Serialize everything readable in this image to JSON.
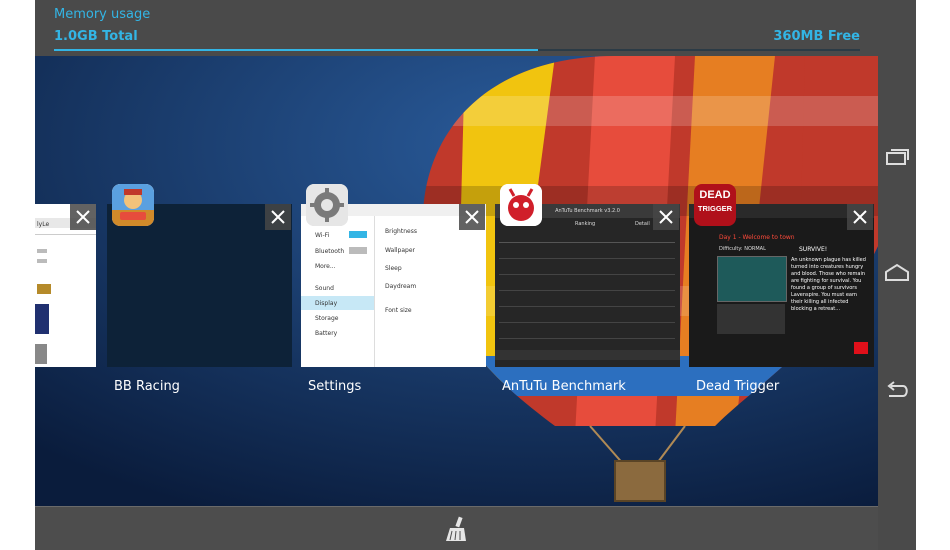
{
  "memory": {
    "title": "Memory usage",
    "total": "1.0GB Total",
    "free": "360MB Free",
    "used_fraction": 0.6
  },
  "recent_apps": [
    {
      "label": "BB Racing",
      "icon": "bb-racing-icon"
    },
    {
      "label": "Settings",
      "icon": "settings-gear-icon"
    },
    {
      "label": "AnTuTu Benchmark",
      "icon": "antutu-icon"
    },
    {
      "label": "Dead Trigger",
      "icon": "dead-trigger-icon"
    }
  ],
  "settings_preview": {
    "wifi": "Wi-Fi",
    "bluetooth": "Bluetooth",
    "more": "More...",
    "sound": "Sound",
    "display": "Display",
    "storage": "Storage",
    "battery": "Battery",
    "brightness": "Brightness",
    "wallpaper": "Wallpaper",
    "sleep": "Sleep",
    "daydream": "Daydream",
    "font_size": "Font size"
  },
  "antutu_preview": {
    "header": "AnTuTu Benchmark v3.2.0",
    "tab_ranking": "Ranking",
    "tab_detail": "Detail"
  },
  "dead_trigger_preview": {
    "logo_line1": "DEAD",
    "logo_line2": "TRIGGER",
    "mission": "Day 1 - Welcome to town",
    "difficulty": "Difficulty: NORMAL",
    "story_title": "SURVIVE!",
    "story_text": "An unknown plague has killed turned into creatures hungry and blood. Those who remain are fighting for survival. You found a group of survivors Lavenspire. You must earn their killing all infected blocking a retreat..."
  },
  "icons": {
    "clear_all": "broom-icon",
    "recents": "recent-apps-icon",
    "home": "home-icon",
    "back": "back-icon"
  },
  "colors": {
    "accent": "#33b5e5",
    "bar": "#4a4a4a"
  }
}
